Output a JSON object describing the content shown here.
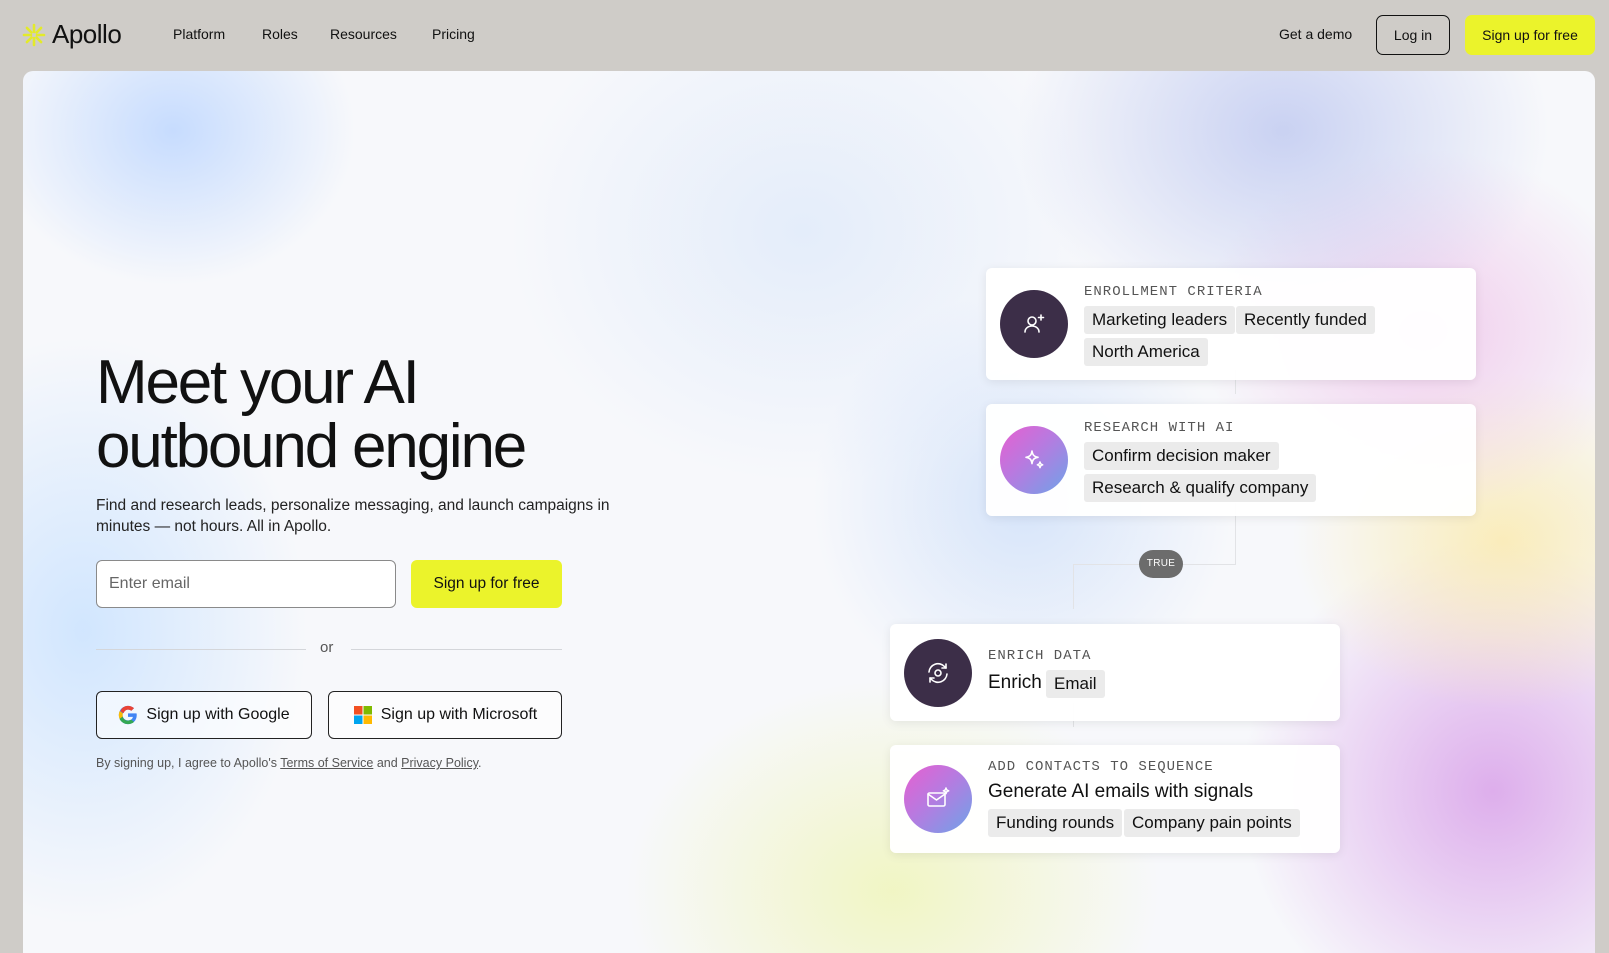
{
  "nav": {
    "brand": "Apollo",
    "links": [
      "Platform",
      "Roles",
      "Resources",
      "Pricing"
    ],
    "demo_label": "Get a demo",
    "login_label": "Log in",
    "signup_label": "Sign up for free"
  },
  "hero": {
    "headline_line1": "Meet your AI",
    "headline_line2": "outbound engine",
    "subtext": "Find and research leads, personalize messaging, and launch campaigns in minutes — not hours. All in Apollo.",
    "email_placeholder": "Enter email",
    "signup_label": "Sign up for free",
    "or_text": "or",
    "google_label": "Sign up with Google",
    "microsoft_label": "Sign up with Microsoft",
    "legal_prefix": "By signing up, I agree to Apollo's",
    "terms_label": "Terms of Service",
    "legal_and": "and",
    "privacy_label": "Privacy Policy",
    "legal_suffix": "."
  },
  "workflow": {
    "enrollment": {
      "label": "ENROLLMENT CRITERIA",
      "chips": [
        "Marketing leaders",
        "Recently funded",
        "North America"
      ]
    },
    "research": {
      "label": "RESEARCH WITH AI",
      "chips": [
        "Confirm decision maker",
        "Research & qualify company"
      ]
    },
    "condition": "TRUE",
    "enrich": {
      "label": "ENRICH DATA",
      "word": "Enrich",
      "chips": [
        "Email"
      ]
    },
    "sequence": {
      "label": "ADD CONTACTS TO SEQUENCE",
      "title": "Generate AI emails with signals",
      "chips": [
        "Funding rounds",
        "Company pain points"
      ]
    }
  },
  "colors": {
    "accent": "#ebf32b",
    "dark_badge": "#3c2e48",
    "nav_bg": "#cfccc8"
  }
}
